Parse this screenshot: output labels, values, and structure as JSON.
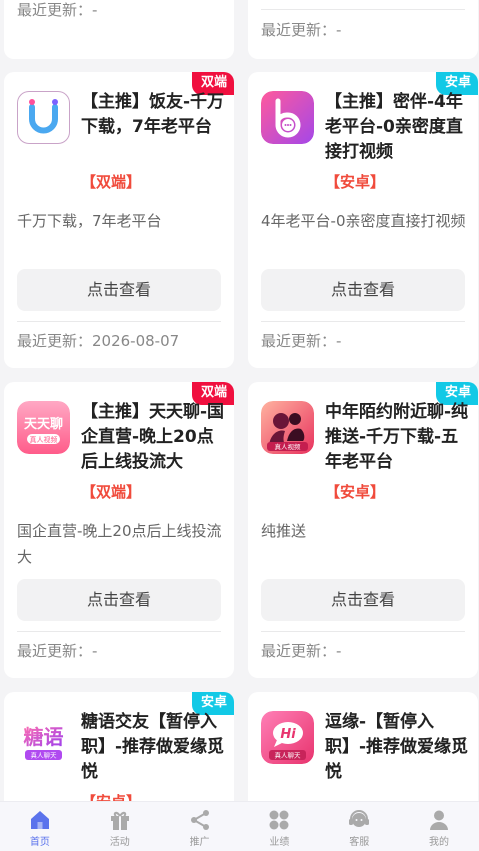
{
  "cards": [
    {
      "title": "",
      "tag": "",
      "badge": "",
      "desc": "",
      "button": "",
      "updated": "最近更新：-"
    },
    {
      "title": "",
      "tag": "",
      "badge": "",
      "desc": "",
      "button": "",
      "updated": "最近更新：-"
    },
    {
      "title": "【主推】饭友-千万下载，7年老平台",
      "tag": "【双端】",
      "badge": "双端",
      "desc": "千万下载，7年老平台",
      "button": "点击查看",
      "updated": "最近更新：2026-08-07",
      "icon": "fanyou-logo-icon"
    },
    {
      "title": "【主推】密伴-4年老平台-0亲密度直接打视频",
      "tag": "【安卓】",
      "badge": "安卓",
      "desc": "4年老平台-0亲密度直接打视频",
      "button": "点击查看",
      "updated": "最近更新：-",
      "icon": "miban-logo-icon"
    },
    {
      "title": "【主推】天天聊-国企直营-晚上20点后上线投流大",
      "tag": "【双端】",
      "badge": "双端",
      "desc": "国企直营-晚上20点后上线投流大",
      "button": "点击查看",
      "updated": "最近更新：-",
      "icon": "tiantianliao-logo-icon",
      "icon_text": "天天聊",
      "icon_sub": "真人视频"
    },
    {
      "title": "中年陌约附近聊-纯推送-千万下载-五年老平台",
      "tag": "【安卓】",
      "badge": "安卓",
      "desc": "纯推送",
      "button": "点击查看",
      "updated": "最近更新：-",
      "icon": "moyue-logo-icon",
      "icon_sub": "真人视频"
    },
    {
      "title": "糖语交友【暂停入职】-推荐做爱缘觅悦",
      "tag": "【安卓】",
      "badge": "安卓",
      "icon": "tangyu-logo-icon",
      "icon_text": "糖语",
      "icon_sub": "真人聊天"
    },
    {
      "title": "逗缘-【暂停入职】-推荐做爱缘觅悦",
      "tag": "",
      "badge": "",
      "icon": "douyuan-logo-icon",
      "icon_text": "Hi",
      "icon_sub": "真人聊天"
    }
  ],
  "tabs": [
    {
      "label": "首页",
      "icon": "home-icon",
      "active": true
    },
    {
      "label": "活动",
      "icon": "gift-icon"
    },
    {
      "label": "推广",
      "icon": "share-icon"
    },
    {
      "label": "业绩",
      "icon": "grid-icon"
    },
    {
      "label": "客服",
      "icon": "headset-icon"
    },
    {
      "label": "我的",
      "icon": "user-icon"
    }
  ],
  "colors": {
    "accent": "#5b73ec",
    "badge_both": "#f0103f",
    "badge_android": "#12c9e6",
    "tag": "#f04b3c"
  }
}
